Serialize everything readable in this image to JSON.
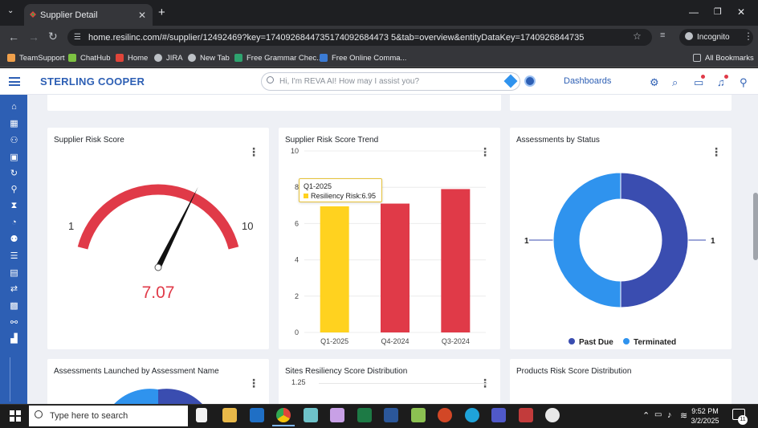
{
  "browser": {
    "tab_title": "Supplier Detail",
    "url": "home.resilinc.com/#/supplier/12492469?key=1740926844735174092684473 5&tab=overview&entityDataKey=1740926844735",
    "profile": "Incognito",
    "bookmarks": [
      "TeamSupport",
      "ChatHub",
      "Home",
      "JIRA",
      "New Tab",
      "Free Grammar Chec...",
      "Free Online Comma..."
    ],
    "all_bookmarks": "All Bookmarks"
  },
  "app": {
    "brand": "STERLING COOPER",
    "search_placeholder": "Hi, I'm REVA AI! How may I assist you?",
    "dashboards_label": "Dashboards"
  },
  "cards": {
    "risk_score": {
      "title": "Supplier Risk Score",
      "min_label": "1",
      "max_label": "10",
      "value_label": "7.07"
    },
    "trend": {
      "title": "Supplier Risk Score Trend",
      "tooltip_title": "Q1-2025",
      "tooltip_label": "Resiliency Risk:",
      "tooltip_value": "6.95"
    },
    "status": {
      "title": "Assessments by Status",
      "left_label": "1",
      "right_label": "1",
      "legend": [
        "Past Due",
        "Terminated"
      ]
    },
    "launched": {
      "title": "Assessments Launched by Assessment Name"
    },
    "sites": {
      "title": "Sites Resiliency Score Distribution",
      "first_tick": "1.25"
    },
    "products": {
      "title": "Products Risk Score Distribution"
    }
  },
  "chart_data": [
    {
      "type": "gauge",
      "title": "Supplier Risk Score",
      "min": 1,
      "max": 10,
      "value": 7.07,
      "color": "#e03a48"
    },
    {
      "type": "bar",
      "title": "Supplier Risk Score Trend",
      "categories": [
        "Q1-2025",
        "Q4-2024",
        "Q3-2024"
      ],
      "values": [
        6.95,
        7.1,
        7.9
      ],
      "colors": [
        "#ffd21f",
        "#e03a48",
        "#e03a48"
      ],
      "ylim": [
        0,
        10
      ],
      "yticks": [
        0,
        2,
        4,
        6,
        8,
        10
      ]
    },
    {
      "type": "pie",
      "title": "Assessments by Status",
      "labels": [
        "Past Due",
        "Terminated"
      ],
      "values": [
        1,
        1
      ],
      "colors": [
        "#3a4db0",
        "#2f93ee"
      ],
      "legend": "bottom"
    }
  ],
  "taskbar": {
    "search_placeholder": "Type here to search",
    "time": "9:52 PM",
    "date": "3/2/2025",
    "notifications": "11"
  }
}
